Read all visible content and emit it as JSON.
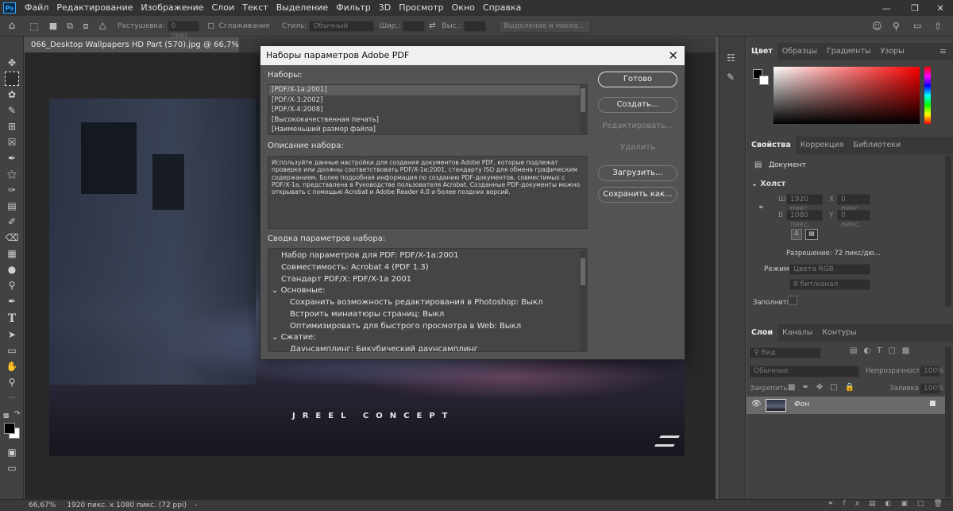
{
  "app": {
    "logo": "Ps",
    "menu": [
      "Файл",
      "Редактирование",
      "Изображение",
      "Слои",
      "Текст",
      "Выделение",
      "Фильтр",
      "3D",
      "Просмотр",
      "Окно",
      "Справка"
    ]
  },
  "options": {
    "feather_label": "Растушевка:",
    "feather_value": "0 пикс.",
    "antialias_label": "Сглаживание",
    "style_label": "Стиль:",
    "style_value": "Обычный",
    "width_label": "Шир.:",
    "height_label": "Выс.:",
    "select_mask_label": "Выделение и маска..."
  },
  "document": {
    "tab_title": "066_Desktop Wallpapers  HD Part (570).jpg @ 66,7% (RGB/8#)",
    "image_caption": "JREEL CONCEPT"
  },
  "status": {
    "zoom": "66,67%",
    "doc_info": "1920 пикс. x 1080 пикс. (72 ppi)"
  },
  "panels": {
    "color_tabs": [
      "Цвет",
      "Образцы",
      "Градиенты",
      "Узоры"
    ],
    "props_tabs": [
      "Свойства",
      "Коррекция",
      "Библиотеки"
    ],
    "props_doc": "Документ",
    "canvas_section": "Холст",
    "w_label": "Ш",
    "w_value": "1920 пикс.",
    "h_label": "В",
    "h_value": "1080 пикс.",
    "x_label": "X",
    "x_value": "0 пикс.",
    "y_label": "Y",
    "y_value": "0 пикс.",
    "resolution": "Разрешение: 72 пикс/дю...",
    "mode_label": "Режим",
    "mode_value": "Цвета RGB",
    "bits_value": "8 бит/канал",
    "fill_label": "Заполнить",
    "layers_tabs": [
      "Слои",
      "Каналы",
      "Контуры"
    ],
    "layer_filter": "Вид",
    "blend_mode": "Обычные",
    "opacity_label": "Непрозрачность:",
    "opacity_value": "100%",
    "lock_label": "Закрепить:",
    "fill2_label": "Заливка:",
    "fill2_value": "100%",
    "layer_name": "Фон"
  },
  "dialog": {
    "title": "Наборы параметров Adobe PDF",
    "presets_label": "Наборы:",
    "presets": [
      "[PDF/X-1a:2001]",
      "[PDF/X-3:2002]",
      "[PDF/X-4:2008]",
      "[Высококачественная печать]",
      "[Наименьший размер файла]"
    ],
    "description_label": "Описание набора:",
    "description": "Используйте данные настройки для создания документов Adobe PDF, которые подлежат проверке или должны соответствовать PDF/X-1a:2001, стандарту ISO для обмена графическим содержанием.  Более подробная информация по созданию PDF-документов, совместимых с PDF/X-1a, представлена в Руководстве пользователя Acrobat.  Созданные PDF-документы можно открывать с помощью Acrobat и Adobe Reader 4.0 и более поздних версий.",
    "summary_label": "Сводка параметров набора:",
    "summary": {
      "line1": "Набор параметров для PDF:  PDF/X-1a:2001",
      "line2": "Совместимость: Acrobat 4 (PDF 1.3)",
      "line3": "Стандарт PDF/X:  PDF/X-1a 2001",
      "section1": "Основные:",
      "line4": "Сохранить возможность редактирования в Photoshop: Выкл",
      "line5": "Встроить миниатюры страниц: Выкл",
      "line6": "Оптимизировать для быстрого просмотра в Web:  Выкл",
      "section2": "Сжатие:",
      "line7": "Даунсамплинг:  Бикубический даунсамплинг"
    },
    "buttons": {
      "done": "Готово",
      "create": "Создать...",
      "edit": "Редактировать...",
      "delete": "Удалить",
      "load": "Загрузить...",
      "save_as": "Сохранить как..."
    }
  }
}
